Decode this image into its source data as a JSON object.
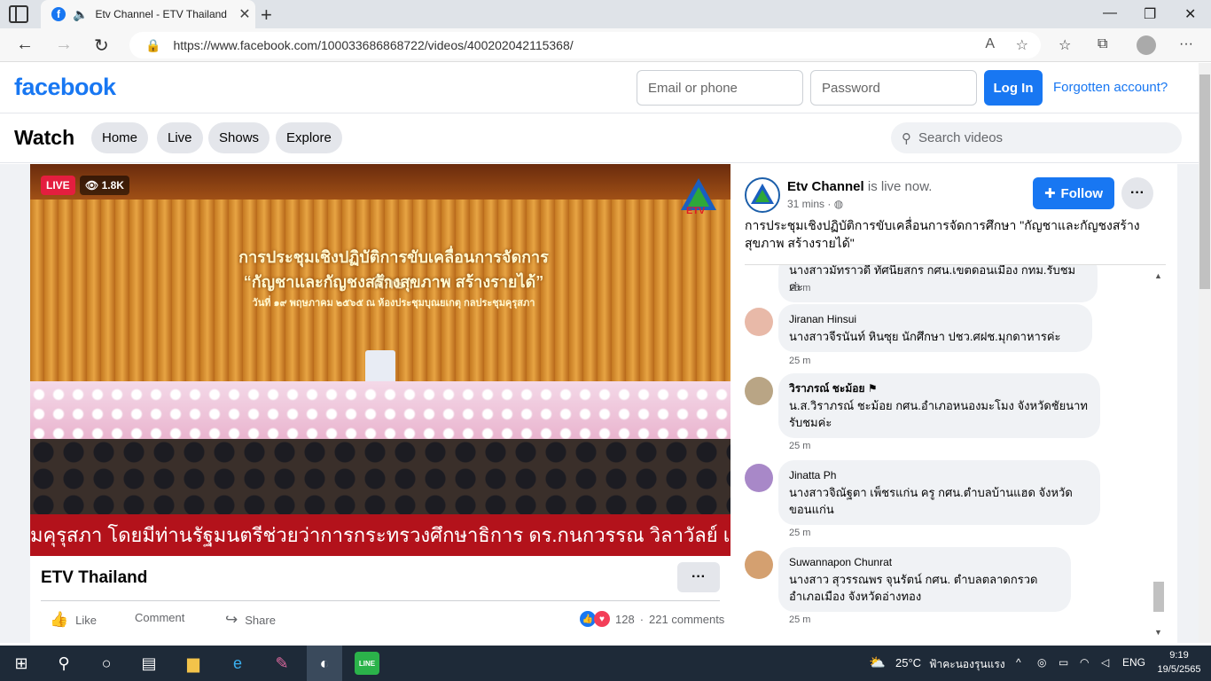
{
  "browser": {
    "tab_title": "Etv Channel - ETV Thailand",
    "url": "https://www.facebook.com/100033686868722/videos/400202042115368/"
  },
  "header": {
    "logo": "facebook",
    "email_placeholder": "Email or phone",
    "password_placeholder": "Password",
    "login_label": "Log In",
    "forgot_label": "Forgotten account?"
  },
  "watch": {
    "title": "Watch",
    "nav": [
      "Home",
      "Live",
      "Shows",
      "Explore"
    ],
    "search_placeholder": "Search videos"
  },
  "video": {
    "live_label": "LIVE",
    "viewers": "1.8K",
    "banner_line1": "การประชุมเชิงปฏิบัติการขับเคลื่อนการจัดการศึกษา",
    "banner_line2": "“กัญชาและกัญชงสร้างสุขภาพ สร้างรายได้”",
    "banner_line3": "วันที่ ๑๙ พฤษภาคม ๒๕๖๕ ณ ห้องประชุมบุณยเกตุ กลประชุมคุรุสภา",
    "ticker": "มคุรุสภา โดยมีท่านรัฐมนตรีช่วยว่าการกระทรวงศึกษาธิการ ดร.กนกวรรณ วิลาวัลย์ เป็น",
    "logo_text": "ETV",
    "title": "ETV Thailand",
    "more_label": "···",
    "like_label": "Like",
    "comment_label": "Comment",
    "share_label": "Share",
    "reaction_count": "128",
    "comments_count": "221 comments"
  },
  "post": {
    "page_name": "Etv Channel",
    "status": "is live now.",
    "time": "31 mins · ",
    "follow_label": "Follow",
    "more_label": "···",
    "description": "การประชุมเชิงปฏิบัติการขับเคลื่อนการจัดการศึกษา \"กัญชาและกัญชงสร้างสุขภาพ สร้างรายได้\""
  },
  "comments": [
    {
      "name": "",
      "text": "นางสาวมัทราวดี ทัศนียสกร กศน.เขตดอนเมือง กทม.รับชมค่ะ",
      "time": "25 m",
      "avatar_color": "#c9a98a"
    },
    {
      "name": "Jiranan Hinsui",
      "text": "นางสาวจีรนันท์ หินซุย นักศึกษา ปชว.ศฝช.มุกดาหารค่ะ",
      "time": "25 m",
      "avatar_color": "#e8b9a8"
    },
    {
      "name": "วิราภรณ์ ชะม้อย",
      "text": "น.ส.วิราภรณ์ ชะม้อย กศน.อำเภอหนองมะโมง จังหวัดชัยนาท รับชมค่ะ",
      "time": "25 m",
      "avatar_color": "#b9a585"
    },
    {
      "name": "Jinatta Ph",
      "text": "นางสาวจิณัฐตา เพ็ชรแก่น ครู กศน.ตำบลบ้านแฮด จังหวัดขอนแก่น",
      "time": "25 m",
      "avatar_color": "#a888c8"
    },
    {
      "name": "Suwannapon Chunrat",
      "text": "นางสาว สุวรรณพร จุนรัตน์ กศน. ตำบลตลาดกรวด อำเภอเมือง จังหวัดอ่างทอง",
      "time": "25 m",
      "avatar_color": "#d4a070"
    }
  ],
  "taskbar": {
    "weather": "25°C",
    "weather_text": "ฟ้าคะนองรุนแรง",
    "lang": "ENG",
    "time": "9:19",
    "date": "19/5/2565"
  }
}
